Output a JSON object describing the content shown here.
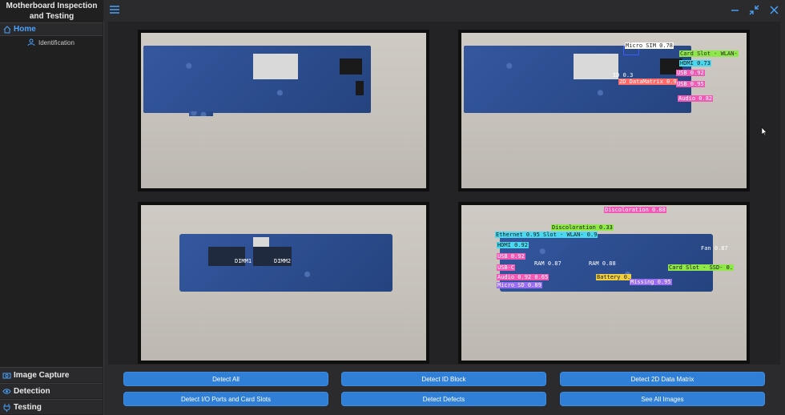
{
  "app": {
    "title": "Motherboard Inspection and Testing"
  },
  "sidebar": {
    "home_label": "Home",
    "sub_items": [
      {
        "label": "Identification"
      }
    ],
    "bottom_items": [
      {
        "label": "Image Capture",
        "icon": "camera-icon"
      },
      {
        "label": "Detection",
        "icon": "eye-icon"
      },
      {
        "label": "Testing",
        "icon": "plug-icon"
      }
    ]
  },
  "colors": {
    "accent": "#2f7fd6",
    "home_text": "#4aa3ff",
    "background": "#2b2b2d"
  },
  "panels": {
    "top_right_labels": [
      "Micro SIM 0.78",
      "Card Slot - WLAN-",
      "HDMI 0.73",
      "USB 0.92",
      "ID 0.3",
      "2D DataMatrix 0.9",
      "USB 0.95",
      "Audio 0.82"
    ],
    "bottom_right_labels": [
      "Discoloration 0.88",
      "Discoloration 0.33",
      "Ethernet 0.95 Slot - WLAN- 0.9",
      "HDMI 0.92",
      "Fan 0.87",
      "USB 0.92",
      "RAM 0.87",
      "RAM 0.88",
      "USB-C",
      "Card Slot - SSD- 0.",
      "Audio 0.92 0.65",
      "Battery 0.",
      "Micro SD 0.89",
      "Missing 0.95"
    ],
    "dimm_labels": [
      "DIMM1",
      "DIMM2"
    ]
  },
  "buttons": {
    "detect_all": "Detect All",
    "detect_id_block": "Detect ID Block",
    "detect_2d_matrix": "Detect 2D Data Matrix",
    "detect_io": "Detect I/O Ports and Card Slots",
    "detect_defects": "Detect Defects",
    "see_all_images": "See All Images"
  },
  "window": {
    "minimize_icon": "minimize-icon",
    "restore_icon": "restore-icon",
    "close_icon": "close-icon"
  }
}
